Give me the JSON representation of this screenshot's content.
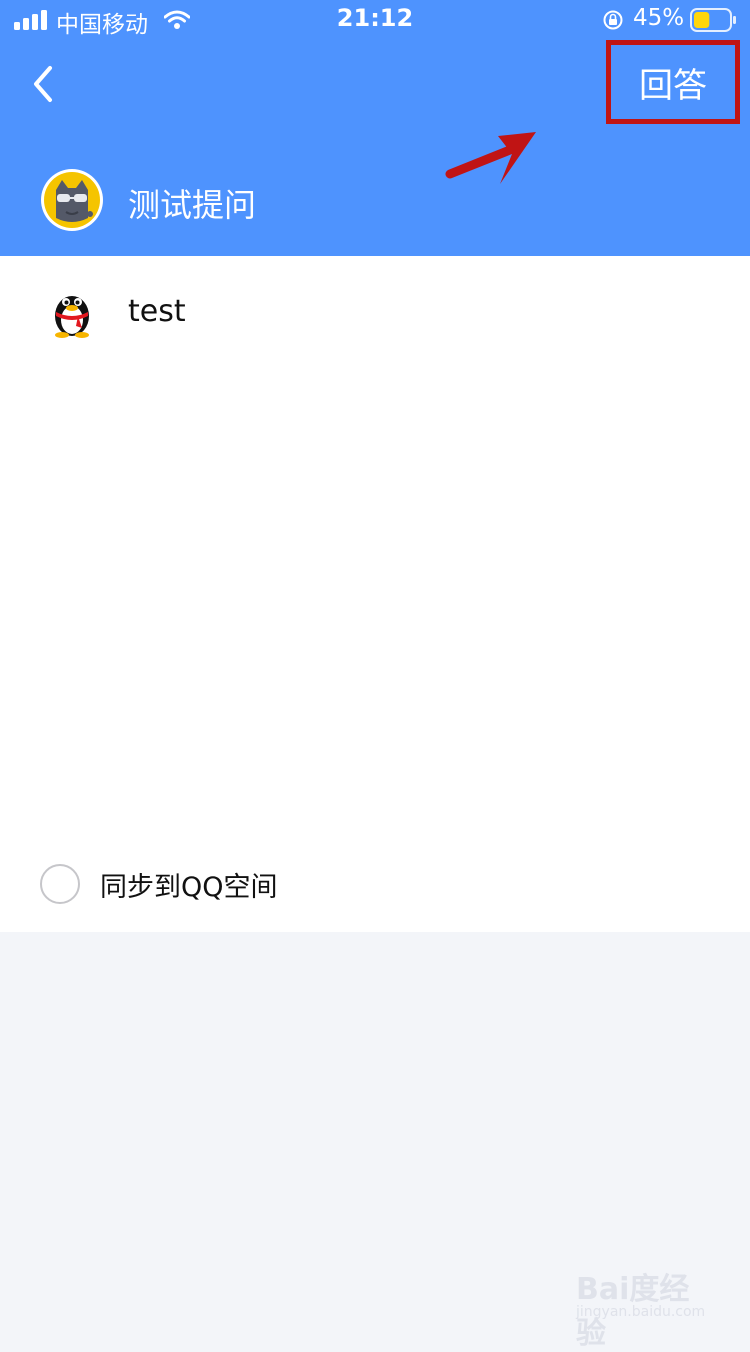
{
  "status_bar": {
    "carrier": "中国移动",
    "time": "21:12",
    "battery_percent": "45%",
    "battery_level": 0.45,
    "battery_color": "#ffd60a"
  },
  "nav": {
    "back_icon": "chevron-left-icon",
    "answer_label": "回答",
    "highlight_color": "#c01414",
    "annotation_arrow": "red-arrow-icon"
  },
  "question": {
    "title": "测试提问",
    "avatar_icon": "cat-avatar-icon"
  },
  "answer": {
    "text": "test",
    "avatar_icon": "qq-penguin-icon"
  },
  "sync": {
    "label": "同步到QQ空间",
    "checked": false
  },
  "watermark": {
    "line1": "Bai度经验",
    "line2": "jingyan.baidu.com"
  },
  "colors": {
    "header": "#4e93fe",
    "content_bg": "#ffffff",
    "page_bg": "#f3f5f9"
  }
}
